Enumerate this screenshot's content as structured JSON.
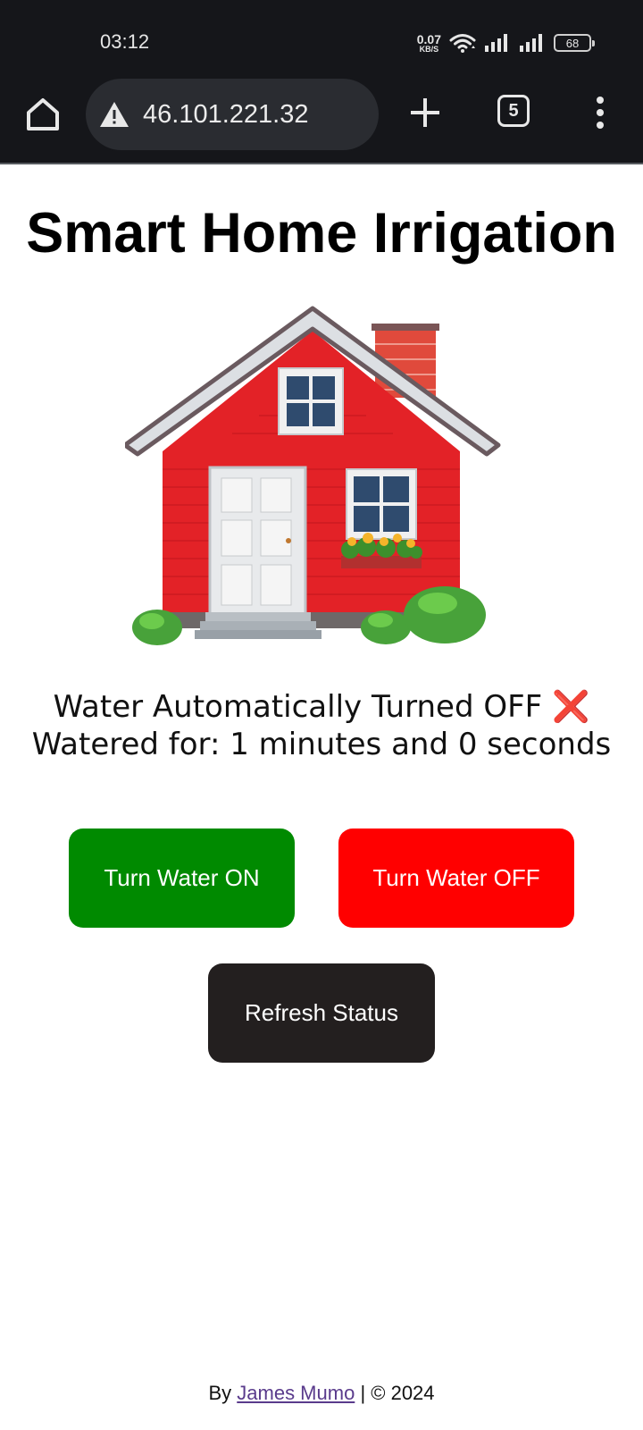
{
  "status_bar": {
    "time": "03:12",
    "speed_value": "0.07",
    "speed_unit": "KB/S",
    "battery": "68"
  },
  "browser": {
    "url": "46.101.221.32",
    "tab_count": "5"
  },
  "page": {
    "title": "Smart Home Irrigation",
    "status_line1": "Water Automatically Turned OFF",
    "status_icon": "❌",
    "status_line2": "Watered for: 1 minutes and 0 seconds",
    "buttons": {
      "on_label": "Turn Water ON",
      "off_label": "Turn Water OFF",
      "refresh_label": "Refresh Status"
    },
    "footer": {
      "prefix": "By",
      "author": "James Mumo",
      "suffix": "| © 2024"
    }
  },
  "colors": {
    "on_button": "#008a00",
    "off_button": "#ff0000",
    "refresh_button": "#231f1f",
    "status_bar_bg": "#15161a"
  },
  "icons": [
    "home-icon",
    "warning-icon",
    "plus-icon",
    "tabs-icon",
    "more-vert-icon",
    "wifi-icon",
    "signal-icon",
    "battery-icon",
    "house-illustration"
  ]
}
